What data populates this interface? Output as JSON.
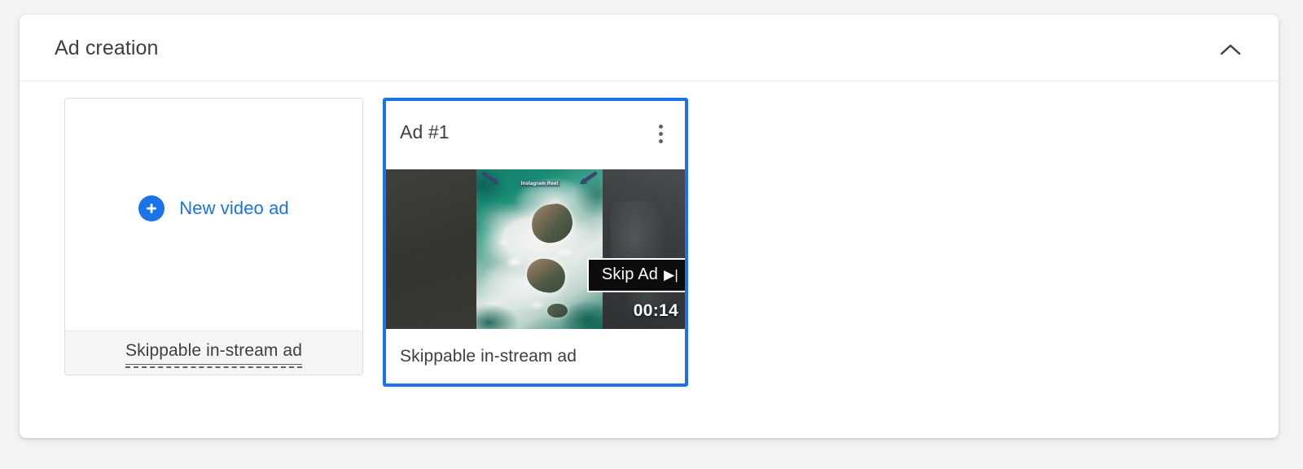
{
  "panel": {
    "title": "Ad creation",
    "collapse_icon": "chevron-up-icon"
  },
  "new_ad_card": {
    "plus_icon": "plus-icon",
    "label": "New video ad",
    "footer_label": "Skippable in-stream ad"
  },
  "ad_card": {
    "title": "Ad #1",
    "menu_icon": "more-vert-icon",
    "footer_label": "Skippable in-stream ad",
    "thumbnail": {
      "overlay_text": "Instagram Reel",
      "left_arrow_icon": "arrow-down-right-icon",
      "right_arrow_icon": "arrow-down-left-icon",
      "skip_label": "Skip Ad",
      "skip_glyph": "▶|",
      "duration": "00:14"
    }
  },
  "colors": {
    "accent": "#1a73e8",
    "text_primary": "#3c4043",
    "page_background": "#f1f3f4",
    "card_border": "#dadce0",
    "footer_background": "#f5f5f5"
  }
}
